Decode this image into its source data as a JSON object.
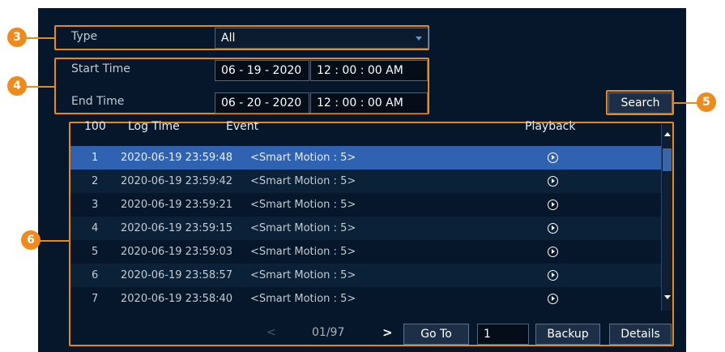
{
  "filters": {
    "type_label": "Type",
    "type_value": "All",
    "start_label": "Start Time",
    "start_date": "06 - 19 - 2020",
    "start_time": "12 : 00 : 00 AM",
    "end_label": "End Time",
    "end_date": "06 - 20 - 2020",
    "end_time": "12 : 00 : 00 AM",
    "search_label": "Search"
  },
  "table": {
    "headers": [
      "100",
      "Log Time",
      "Event",
      "Playback"
    ],
    "selected_row": 1,
    "rows": [
      {
        "num": "1",
        "time": "2020-06-19 23:59:48",
        "event": "<Smart Motion : 5>"
      },
      {
        "num": "2",
        "time": "2020-06-19 23:59:42",
        "event": "<Smart Motion : 5>"
      },
      {
        "num": "3",
        "time": "2020-06-19 23:59:21",
        "event": "<Smart Motion : 5>"
      },
      {
        "num": "4",
        "time": "2020-06-19 23:59:15",
        "event": "<Smart Motion : 5>"
      },
      {
        "num": "5",
        "time": "2020-06-19 23:59:03",
        "event": "<Smart Motion : 5>"
      },
      {
        "num": "6",
        "time": "2020-06-19 23:58:57",
        "event": "<Smart Motion : 5>"
      },
      {
        "num": "7",
        "time": "2020-06-19 23:58:40",
        "event": "<Smart Motion : 5>"
      }
    ]
  },
  "pagination": {
    "prev": "<",
    "page": "01/97",
    "next": ">",
    "goto_label": "Go To",
    "goto_value": "1",
    "backup_label": "Backup",
    "details_label": "Details"
  },
  "markers": [
    "3",
    "4",
    "5",
    "6"
  ],
  "colors": {
    "accent": "#e8891b",
    "panel": "#07172b",
    "row_selected": "#2f63b2",
    "row_alt": "#0b2138"
  }
}
